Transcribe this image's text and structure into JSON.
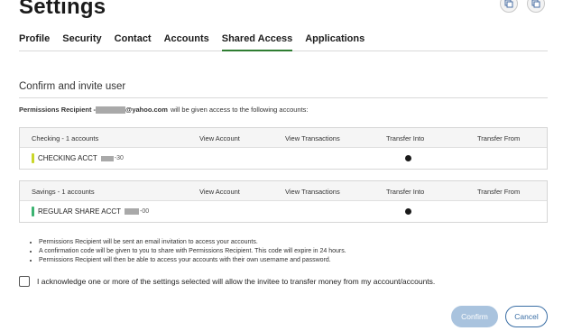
{
  "page": {
    "title": "Settings"
  },
  "tabs": [
    {
      "label": "Profile"
    },
    {
      "label": "Security"
    },
    {
      "label": "Contact"
    },
    {
      "label": "Accounts"
    },
    {
      "label": "Shared Access"
    },
    {
      "label": "Applications"
    }
  ],
  "active_tab": "Shared Access",
  "section": {
    "title": "Confirm and invite user",
    "recipient_label": "Permissions Recipient -",
    "recipient_email_suffix": "@yahoo.com",
    "recipient_text": "will be given access to the following accounts:"
  },
  "checking": {
    "group_label": "Checking - 1 accounts",
    "columns": [
      "View Account",
      "View Transactions",
      "Transfer Into",
      "Transfer From"
    ],
    "account_name": "CHECKING ACCT",
    "account_suffix": "-30",
    "accent_color": "#c9d62a",
    "permissions": {
      "view_account": false,
      "view_transactions": false,
      "transfer_into": true,
      "transfer_from": false
    }
  },
  "savings": {
    "group_label": "Savings - 1 accounts",
    "columns": [
      "View Account",
      "View Transactions",
      "Transfer Into",
      "Transfer From"
    ],
    "account_name": "REGULAR SHARE ACCT",
    "account_suffix": "-00",
    "accent_color": "#3cb371",
    "permissions": {
      "view_account": false,
      "view_transactions": false,
      "transfer_into": true,
      "transfer_from": false
    }
  },
  "notes": [
    "Permissions Recipient will be sent an email invitation to access your accounts.",
    "A confirmation code will be given to you to share with Permissions Recipient. This code will expire in 24 hours.",
    "Permissions Recipient will then be able to access your accounts with their own username and password."
  ],
  "acknowledgement": "I acknowledge one or more of the settings selected will allow the invitee to transfer money from my account/accounts.",
  "buttons": {
    "confirm": "Confirm",
    "cancel": "Cancel"
  },
  "colors": {
    "active_tab_underline": "#2e7d32",
    "confirm_bg": "#a9c3de",
    "cancel_border": "#3a6ea5"
  }
}
